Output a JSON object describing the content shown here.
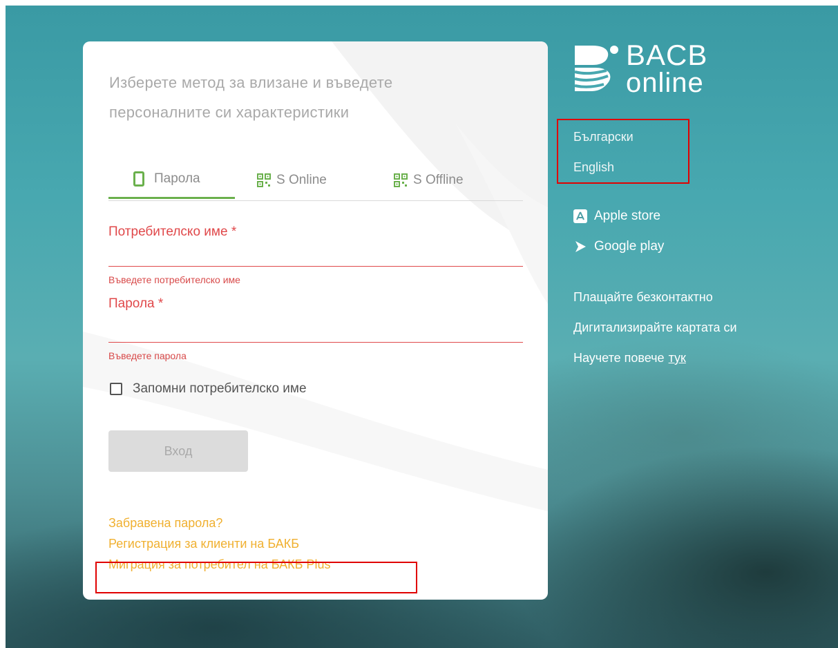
{
  "login": {
    "intro": "Изберете метод за влизане и въведете персоналните си характеристики",
    "tabs": [
      {
        "label": "Парола",
        "icon": "phone-icon",
        "active": true
      },
      {
        "label": "S Online",
        "icon": "qr-icon",
        "active": false
      },
      {
        "label": "S Offline",
        "icon": "qr-icon",
        "active": false
      }
    ],
    "username": {
      "label": "Потребителско име *",
      "error": "Въведете потребителско име"
    },
    "password": {
      "label": "Парола *",
      "error": "Въведете парола"
    },
    "remember_label": "Запомни потребителско име",
    "submit_label": "Вход",
    "links": {
      "forgot": "Забравена парола?",
      "register": "Регистрация за клиенти на БАКБ",
      "migration": "Миграция за потребител на БАКБ Plus"
    }
  },
  "sidebar": {
    "logo": {
      "line1": "BACB",
      "line2": "online"
    },
    "languages": [
      "Български",
      "English"
    ],
    "stores": [
      {
        "label": "Apple store",
        "icon": "apple-store-icon"
      },
      {
        "label": "Google play",
        "icon": "google-play-icon"
      }
    ],
    "promo": {
      "line1": "Плащайте безконтактно",
      "line2": "Дигитализирайте картата си",
      "line3": "Научете повече",
      "link": "тук"
    }
  },
  "colors": {
    "accent_green": "#6ab04c",
    "error_red": "#e0484a",
    "link_orange": "#f0b030",
    "highlight_red": "#e00000"
  }
}
